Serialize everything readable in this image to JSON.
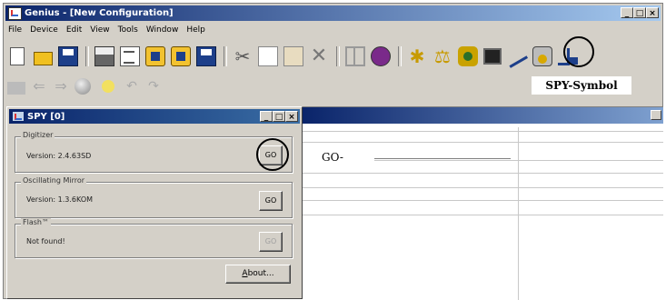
{
  "main_window": {
    "title": "Genius - [New Configuration]",
    "controls": [
      "_",
      "□",
      "×"
    ]
  },
  "menu": [
    "File",
    "Device",
    "Edit",
    "View",
    "Tools",
    "Window",
    "Help"
  ],
  "toolbar1_icons": [
    "new-icon",
    "open-icon",
    "save-icon",
    "print-icon",
    "document-icon",
    "config-1-icon",
    "config-2-icon",
    "config-3-icon",
    "cut-icon",
    "copy-icon",
    "paste-icon",
    "delete-icon",
    "tile-icon",
    "book-icon",
    "gear-icon",
    "scale-icon",
    "puzzle-icon",
    "monitor-icon",
    "wand-icon",
    "spy-icon",
    "network-icon"
  ],
  "toolbar2_icons": [
    "folder-icon",
    "back-arrow-icon",
    "forward-arrow-icon",
    "ball-icon",
    "bulb-icon",
    "undo-icon",
    "redo-icon"
  ],
  "annotations": {
    "spy_symbol_label": "SPY-Symbol",
    "go_label": "GO-"
  },
  "spy_dialog": {
    "title": "SPY [0]",
    "controls": [
      "_",
      "□",
      "×"
    ],
    "groups": [
      {
        "legend": "Digitizer",
        "value": "Version: 2.4.63SD",
        "button": "GO",
        "button_enabled": true
      },
      {
        "legend": "Oscillating Mirror",
        "value": "Version: 1.3.6KOM",
        "button": "GO",
        "button_enabled": true
      },
      {
        "legend": "Flash™",
        "value": "Not found!",
        "button": "GO",
        "button_enabled": false
      }
    ],
    "about_button": {
      "accel": "A",
      "rest": "bout..."
    }
  }
}
